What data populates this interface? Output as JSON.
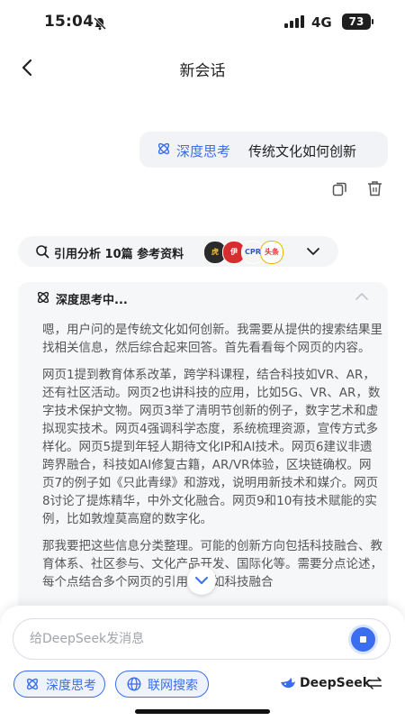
{
  "status_bar": {
    "time": "15:04",
    "network": "4G",
    "battery": "73"
  },
  "header": {
    "title": "新会话"
  },
  "user_message": {
    "mode_tag": "深度思考",
    "text": "传统文化如何创新"
  },
  "references": {
    "label": "引用分析 10篇 参考资料",
    "sources": [
      "虎",
      "伊",
      "CPR",
      "头条"
    ]
  },
  "thinking": {
    "title": "深度思考中...",
    "paragraphs": [
      "嗯，用户问的是传统文化如何创新。我需要从提供的搜索结果里找相关信息，然后综合起来回答。首先看看每个网页的内容。",
      "网页1提到教育体系改革，跨学科课程，结合科技如VR、AR，还有社区活动。网页2也讲科技的应用，比如5G、VR、AR，数字技术保护文物。网页3举了清明节创新的例子，数字艺术和虚拟现实技术。网页4强调科学态度，系统梳理资源，宣传方式多样化。网页5提到年轻人期待文化IP和AI技术。网页6建议非遗跨界融合，科技如AI修复古籍，AR/VR体验，区块链确权。网页7的例子如《只此青绿》和游戏，说明用新技术和媒介。网页8讨论了提炼精华，中外文化融合。网页9和10有技术赋能的实例，比如敦煌莫高窟的数字化。",
      "那我要把这些信息分类整理。可能的创新方向包括科技融合、教育体系、社区参与、文化产品开发、国际化等。需要分点论述，每个点结合多个网页的引用，比如科技融合"
    ]
  },
  "composer": {
    "placeholder": "给DeepSeek发消息",
    "deep_think_label": "深度思考",
    "web_search_label": "联网搜索",
    "model_name": "DeepSeek"
  },
  "colors": {
    "accent": "#3a6df0",
    "bubble_bg": "#f1f3f6",
    "panel_bg": "#f6f7f9"
  },
  "icons": [
    "back-arrow",
    "deepthink-atom",
    "copy",
    "trash",
    "search-quote",
    "chevron-down",
    "chevron-up",
    "globe",
    "whale-logo",
    "switch-arrows",
    "stop"
  ]
}
